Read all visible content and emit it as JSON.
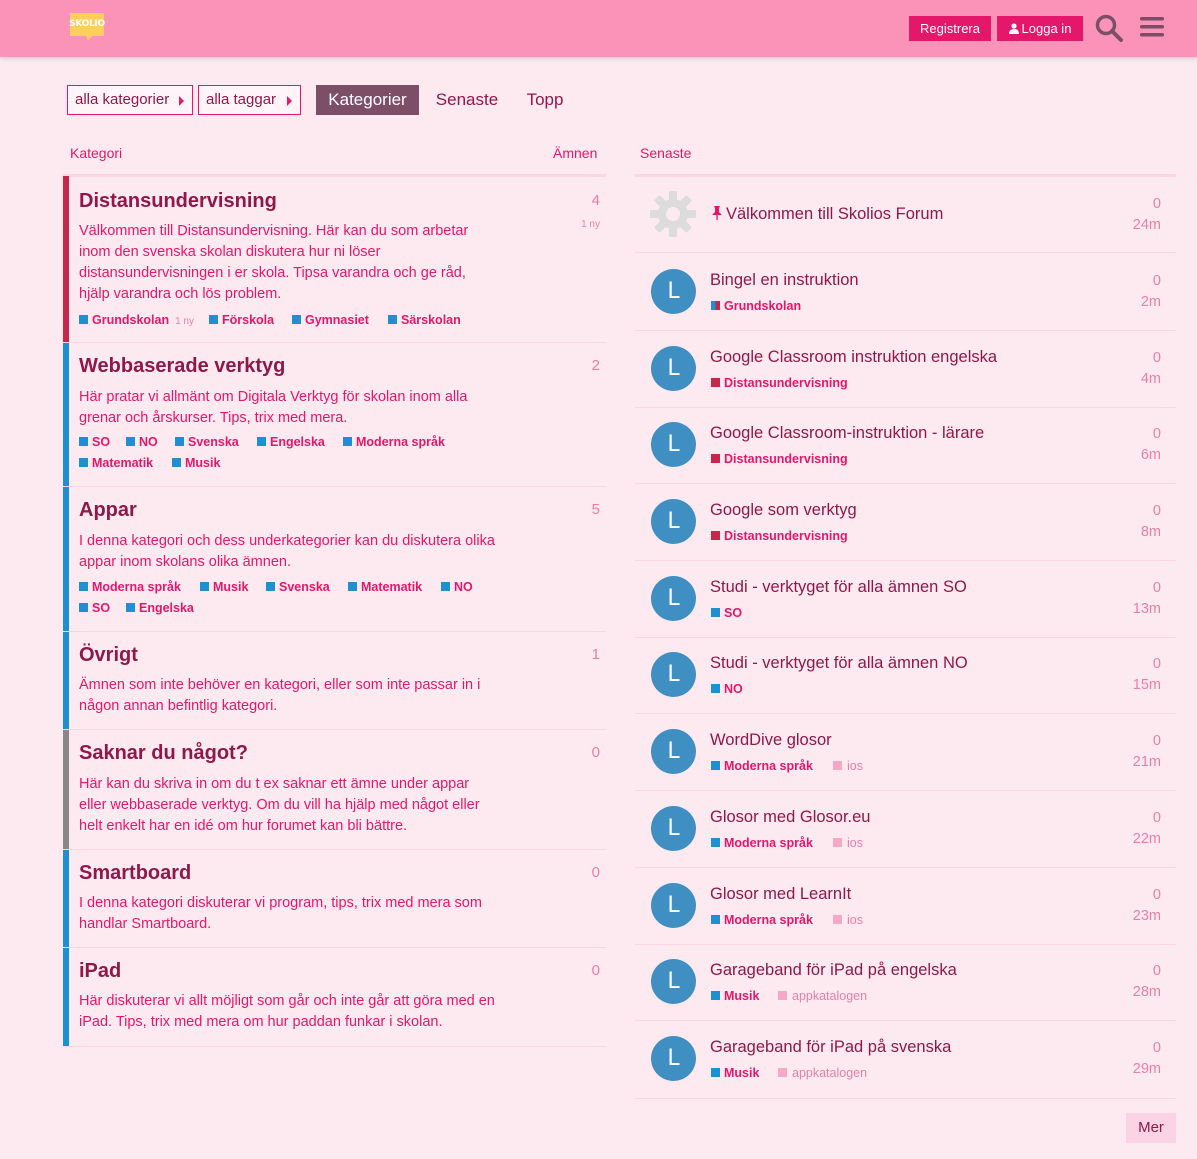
{
  "header": {
    "logo_text": "SKOLIO",
    "register_label": "Registrera",
    "login_label": "Logga in"
  },
  "nav": {
    "categories_dropdown": "alla kategorier",
    "tags_dropdown": "alla taggar",
    "tabs": [
      "Kategorier",
      "Senaste",
      "Topp"
    ]
  },
  "columns": {
    "category": "Kategori",
    "topics": "Ämnen",
    "latest": "Senaste"
  },
  "categories": [
    {
      "title": "Distansundervisning",
      "color": "#c8264a",
      "count": "4",
      "new": "1 ny",
      "desc_lines": [
        "Välkommen till Distansundervisning. Här kan du som arbetar",
        "inom den svenska skolan diskutera hur ni löser",
        "distansundervisningen i er skola. Tipsa varandra och ge råd,",
        "hjälp varandra och lös problem."
      ],
      "subcategories": [
        {
          "name": "Grundskolan",
          "new": "1 ny"
        },
        {
          "name": "Förskola"
        },
        {
          "name": "Gymnasiet"
        },
        {
          "name": "Särskolan"
        }
      ]
    },
    {
      "title": "Webbaserade verktyg",
      "color": "#1e8fd0",
      "count": "2",
      "desc_lines": [
        "Här pratar vi allmänt om Digitala Verktyg för skolan inom alla",
        "grenar och årskurser. Tips, trix med mera."
      ],
      "subcategories": [
        {
          "name": "SO"
        },
        {
          "name": "NO"
        },
        {
          "name": "Svenska"
        },
        {
          "name": "Engelska"
        },
        {
          "name": "Moderna språk"
        },
        {
          "name": "Matematik"
        },
        {
          "name": "Musik"
        }
      ]
    },
    {
      "title": "Appar",
      "color": "#1e8fd0",
      "count": "5",
      "desc_lines": [
        "I denna kategori och dess underkategorier kan du diskutera olika",
        "appar inom skolans olika ämnen."
      ],
      "subcategories": [
        {
          "name": "Moderna språk"
        },
        {
          "name": "Musik"
        },
        {
          "name": "Svenska"
        },
        {
          "name": "Matematik"
        },
        {
          "name": "NO"
        },
        {
          "name": "SO"
        },
        {
          "name": "Engelska"
        }
      ]
    },
    {
      "title": "Övrigt",
      "color": "#1e8fd0",
      "count": "1",
      "desc_lines": [
        "Ämnen som inte behöver en kategori, eller som inte passar in i",
        "någon annan befintlig kategori."
      ],
      "subcategories": []
    },
    {
      "title": "Saknar du något?",
      "color": "#888888",
      "count": "0",
      "desc_lines": [
        "Här kan du skriva in om du t ex saknar ett ämne under appar",
        "eller webbaserade verktyg. Om du vill ha hjälp med något eller",
        "helt enkelt har en idé om hur forumet kan bli bättre."
      ],
      "subcategories": []
    },
    {
      "title": "Smartboard",
      "color": "#1e8fd0",
      "count": "0",
      "desc_lines": [
        "I denna kategori diskuterar vi program, tips, trix med mera som",
        "handlar Smartboard."
      ],
      "subcategories": []
    },
    {
      "title": "iPad",
      "color": "#1e8fd0",
      "count": "0",
      "desc_lines": [
        "Här diskuterar vi allt möjligt som går och inte går att göra med en",
        "iPad. Tips, trix med mera om hur paddan funkar i skolan."
      ],
      "subcategories": []
    }
  ],
  "topics": [
    {
      "title": "Välkommen till Skolios Forum",
      "pinned": true,
      "avatar": "gear",
      "replies": "0",
      "age": "24m"
    },
    {
      "title": "Bingel en instruktion",
      "avatar": "L",
      "category": "Grundskolan",
      "cat_color": "#c8264a",
      "cat_color2": "#1e8fd0",
      "replies": "0",
      "age": "2m"
    },
    {
      "title": "Google Classroom instruktion engelska",
      "avatar": "L",
      "category": "Distansundervisning",
      "cat_color": "#c8264a",
      "replies": "0",
      "age": "4m"
    },
    {
      "title": "Google Classroom-instruktion - lärare",
      "avatar": "L",
      "category": "Distansundervisning",
      "cat_color": "#c8264a",
      "replies": "0",
      "age": "6m"
    },
    {
      "title": "Google som verktyg",
      "avatar": "L",
      "category": "Distansundervisning",
      "cat_color": "#c8264a",
      "replies": "0",
      "age": "8m"
    },
    {
      "title": "Studi - verktyget för alla ämnen SO",
      "avatar": "L",
      "category": "SO",
      "cat_color": "#1e8fd0",
      "replies": "0",
      "age": "13m"
    },
    {
      "title": "Studi - verktyget för alla ämnen NO",
      "avatar": "L",
      "category": "NO",
      "cat_color": "#1e8fd0",
      "replies": "0",
      "age": "15m"
    },
    {
      "title": "WordDive glosor",
      "avatar": "L",
      "category": "Moderna språk",
      "cat_color": "#1e8fd0",
      "tag": "ios",
      "replies": "0",
      "age": "21m"
    },
    {
      "title": "Glosor med Glosor.eu",
      "avatar": "L",
      "category": "Moderna språk",
      "cat_color": "#1e8fd0",
      "tag": "ios",
      "replies": "0",
      "age": "22m"
    },
    {
      "title": "Glosor med LearnIt",
      "avatar": "L",
      "category": "Moderna språk",
      "cat_color": "#1e8fd0",
      "tag": "ios",
      "replies": "0",
      "age": "23m"
    },
    {
      "title": "Garageband för iPad på engelska",
      "avatar": "L",
      "category": "Musik",
      "cat_color": "#1e8fd0",
      "tag": "appkatalogen",
      "replies": "0",
      "age": "28m"
    },
    {
      "title": "Garageband för iPad på svenska",
      "avatar": "L",
      "category": "Musik",
      "cat_color": "#1e8fd0",
      "tag": "appkatalogen",
      "replies": "0",
      "age": "29m"
    }
  ],
  "more_label": "Mer",
  "colors": {
    "header_bg": "#fa93b7",
    "page_bg": "#fdeaf0",
    "primary": "#e4176a",
    "title_text": "#8f1848",
    "active_tab": "#7d4e68",
    "subcat_blue": "#1e8fd0",
    "tag_square": "#f6a9c6"
  },
  "icons": [
    "skolio-logo",
    "user-icon",
    "search-icon",
    "hamburger-menu-icon",
    "pin-icon",
    "gear-icon"
  ]
}
